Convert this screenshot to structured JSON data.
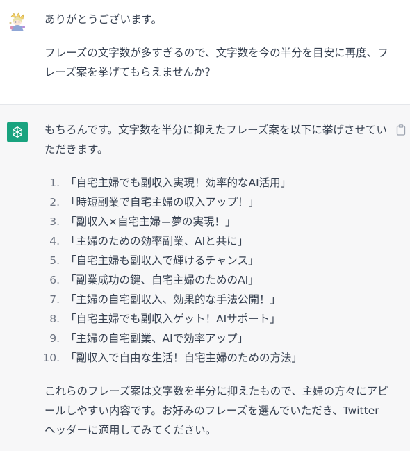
{
  "user_message": {
    "line1": "ありがとうございます。",
    "line2": "フレーズの文字数が多すぎるので、文字数を今の半分を目安に再度、フレーズ案を挙げてもらえませんか？"
  },
  "assistant_message": {
    "intro": "もちろんです。文字数を半分に抑えたフレーズ案を以下に挙げさせていただきます。",
    "items": [
      {
        "num": "1.",
        "text": "「自宅主婦でも副収入実現！効率的なAI活用」"
      },
      {
        "num": "2.",
        "text": "「時短副業で自宅主婦の収入アップ！」"
      },
      {
        "num": "3.",
        "text": "「副収入×自宅主婦＝夢の実現！」"
      },
      {
        "num": "4.",
        "text": "「主婦のための効率副業、AIと共に」"
      },
      {
        "num": "5.",
        "text": "「自宅主婦も副収入で輝けるチャンス」"
      },
      {
        "num": "6.",
        "text": "「副業成功の鍵、自宅主婦のためのAI」"
      },
      {
        "num": "7.",
        "text": "「主婦の自宅副収入、効果的な手法公開！」"
      },
      {
        "num": "8.",
        "text": "「自宅主婦でも副収入ゲット！AIサポート」"
      },
      {
        "num": "9.",
        "text": "「主婦の自宅副業、AIで効率アップ」"
      },
      {
        "num": "10.",
        "text": "「副収入で自由な生活！自宅主婦のための方法」"
      }
    ],
    "outro": "これらのフレーズ案は文字数を半分に抑えたもので、主婦の方々にアピールしやすい内容です。お好みのフレーズを選んでいただき、Twitterヘッダーに適用してみてください。"
  },
  "icons": {
    "user_avatar": "user-avatar-illustration",
    "bot_avatar": "openai-logo-icon",
    "copy": "clipboard-icon"
  },
  "colors": {
    "bot_avatar_bg": "#19a37f",
    "assistant_bg": "#f7f7f8",
    "text": "#374151"
  }
}
